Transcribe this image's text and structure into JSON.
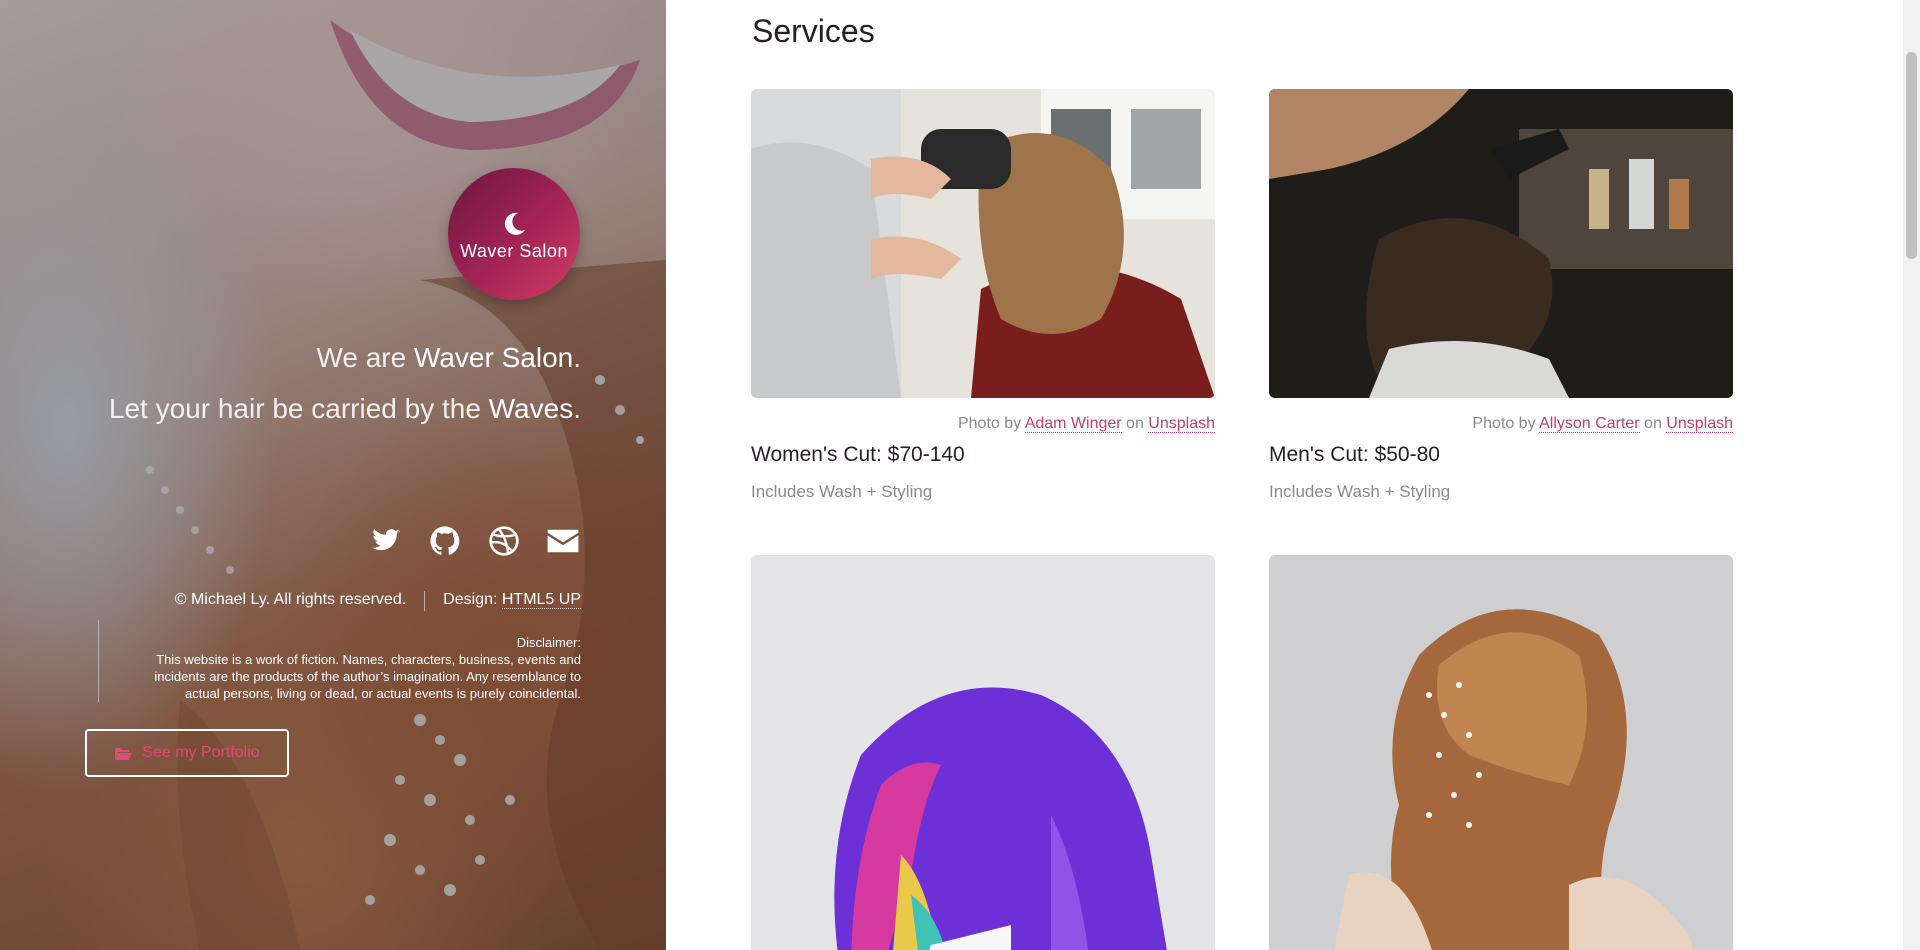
{
  "hero": {
    "logo": {
      "text": "Waver Salon",
      "icon": "crescent-moon-icon"
    },
    "tagline1": {
      "prefix": "We are ",
      "highlight": "Waver Salon",
      "suffix": "."
    },
    "tagline2": {
      "prefix": "Let your hair be carried by the ",
      "highlight": "Waves",
      "suffix": "."
    },
    "socials": [
      {
        "name": "twitter-icon"
      },
      {
        "name": "github-icon"
      },
      {
        "name": "dribbble-icon"
      },
      {
        "name": "envelope-icon"
      }
    ],
    "copyright": {
      "text": "© Michael Ly. All rights reserved.",
      "design_label": "Design: ",
      "design_link": "HTML5 UP"
    },
    "disclaimer": {
      "title": "Disclaimer:",
      "body": "This website is a work of fiction. Names, characters, business, events and incidents are the products of the author’s imagination. Any resemblance to actual persons, living or dead, or actual events is purely coincidental."
    },
    "portfolio_button": {
      "label": "See my Portfolio",
      "icon": "folder-open-icon"
    }
  },
  "main": {
    "section_title": "Services",
    "cards": [
      {
        "photographer": "Adam Winger",
        "source": "Unsplash",
        "title": "Women's Cut: $70-140",
        "desc": "Includes Wash + Styling"
      },
      {
        "photographer": "Allyson Carter",
        "source": "Unsplash",
        "title": "Men's Cut: $50-80",
        "desc": "Includes Wash + Styling"
      },
      {
        "photographer": "",
        "source": "",
        "title": "",
        "desc": ""
      },
      {
        "photographer": "",
        "source": "",
        "title": "",
        "desc": ""
      }
    ],
    "credit_prefix": "Photo by ",
    "credit_mid": " on "
  },
  "colors": {
    "accent": "#c2406a",
    "logo_start": "#6b1640",
    "logo_end": "#d13d66"
  }
}
